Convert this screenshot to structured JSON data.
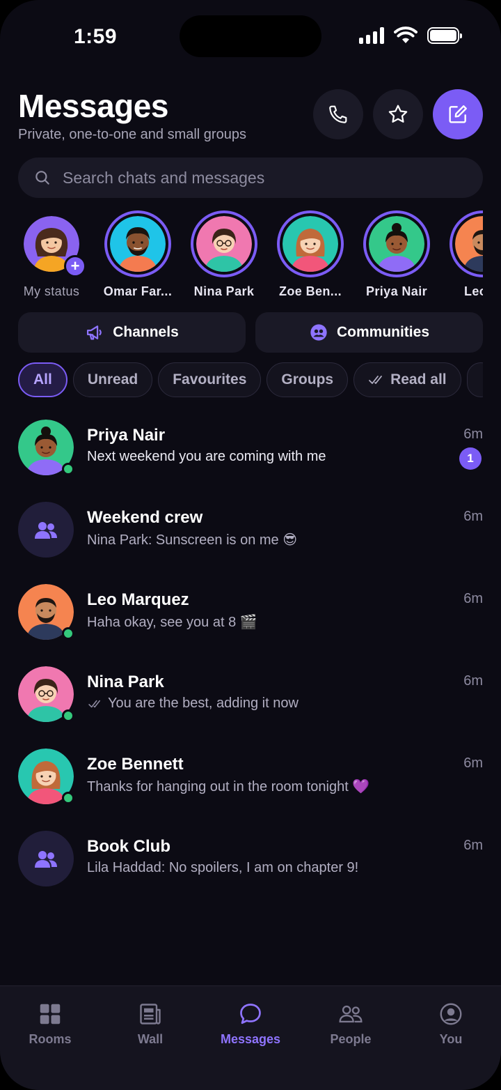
{
  "status_bar": {
    "time": "1:59"
  },
  "header": {
    "title": "Messages",
    "subtitle": "Private, one-to-one and small groups"
  },
  "search": {
    "placeholder": "Search chats and messages"
  },
  "stories": [
    {
      "name": "My status",
      "icon": "add-icon"
    },
    {
      "name": "Omar Far..."
    },
    {
      "name": "Nina Park"
    },
    {
      "name": "Zoe Ben..."
    },
    {
      "name": "Priya Nair"
    },
    {
      "name": "Leo M"
    }
  ],
  "sections": {
    "channels": "Channels",
    "communities": "Communities"
  },
  "filters": [
    "All",
    "Unread",
    "Favourites",
    "Groups",
    "Read all"
  ],
  "chats": [
    {
      "name": "Priya Nair",
      "preview": "Next weekend you are coming with me",
      "time": "6m",
      "unread": "1"
    },
    {
      "name": "Weekend crew",
      "preview": "Nina Park: Sunscreen is on me 😎",
      "time": "6m"
    },
    {
      "name": "Leo Marquez",
      "preview": "Haha okay, see you at 8 🎬",
      "time": "6m"
    },
    {
      "name": "Nina Park",
      "preview": "You are the best, adding it now",
      "time": "6m"
    },
    {
      "name": "Zoe Bennett",
      "preview": "Thanks for hanging out in the room tonight 💜",
      "time": "6m"
    },
    {
      "name": "Book Club",
      "preview": "Lila Haddad: No spoilers, I am on chapter 9!",
      "time": "6m"
    }
  ],
  "nav": [
    {
      "label": "Rooms"
    },
    {
      "label": "Wall"
    },
    {
      "label": "Messages"
    },
    {
      "label": "People"
    },
    {
      "label": "You"
    }
  ],
  "colors": {
    "accent": "#7b5cf5",
    "online": "#34c97c",
    "background": "#0c0b14"
  }
}
